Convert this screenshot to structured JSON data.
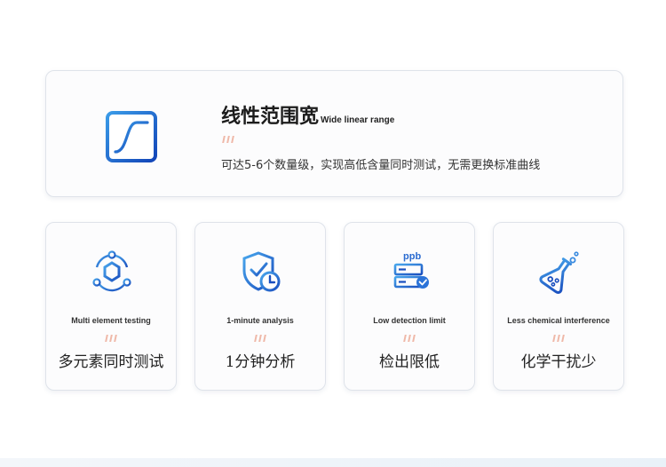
{
  "colors": {
    "accent_blue": "#1f6fd6",
    "tick_pink": "#efb8a8"
  },
  "highlight": {
    "icon": "s-curve-icon",
    "title_zh": "线性范围宽",
    "title_en": "Wide linear range",
    "description": "可达5-6个数量级，实现高低含量同时测试，无需更换标准曲线"
  },
  "features": [
    {
      "icon": "hexagon-network-icon",
      "title_en": "Multi element testing",
      "title_zh": "多元素同时测试"
    },
    {
      "icon": "shield-clock-icon",
      "title_en": "1-minute analysis",
      "title_zh": "1分钟分析"
    },
    {
      "icon": "ppb-server-icon",
      "title_en": "Low detection limit",
      "title_zh": "检出限低",
      "icon_text": "ppb"
    },
    {
      "icon": "flask-icon",
      "title_en": "Less chemical interference",
      "title_zh": "化学干扰少"
    }
  ]
}
